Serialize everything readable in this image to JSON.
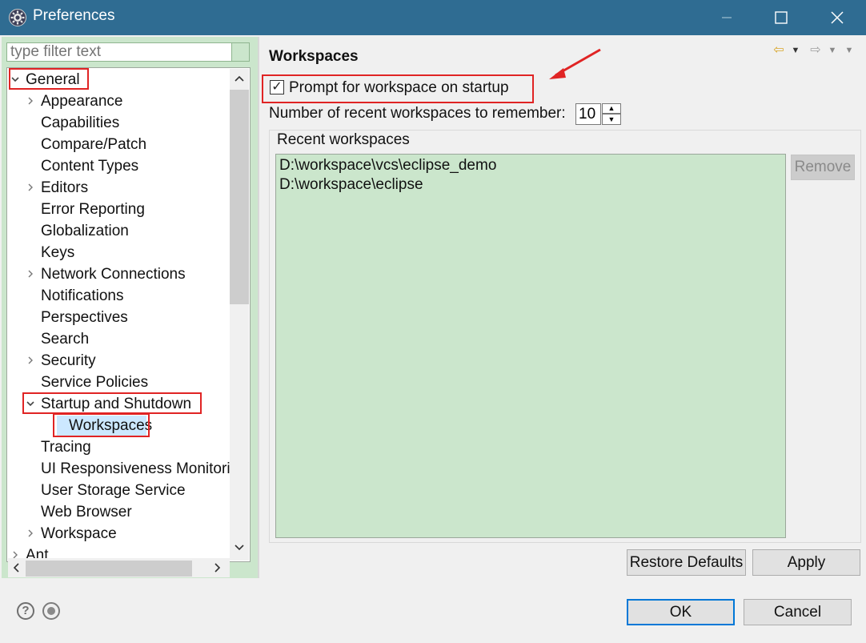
{
  "window": {
    "title": "Preferences",
    "icon": "eclipse-gear-icon",
    "buttons": [
      "minimize",
      "maximize",
      "close"
    ]
  },
  "filter": {
    "placeholder": "type filter text",
    "value": ""
  },
  "tree": {
    "items": [
      {
        "label": "General",
        "twisty": "expanded",
        "level": 0
      },
      {
        "label": "Appearance",
        "twisty": "collapsed",
        "level": 1
      },
      {
        "label": "Capabilities",
        "twisty": "none",
        "level": 1
      },
      {
        "label": "Compare/Patch",
        "twisty": "none",
        "level": 1
      },
      {
        "label": "Content Types",
        "twisty": "none",
        "level": 1
      },
      {
        "label": "Editors",
        "twisty": "collapsed",
        "level": 1
      },
      {
        "label": "Error Reporting",
        "twisty": "none",
        "level": 1
      },
      {
        "label": "Globalization",
        "twisty": "none",
        "level": 1
      },
      {
        "label": "Keys",
        "twisty": "none",
        "level": 1
      },
      {
        "label": "Network Connections",
        "twisty": "collapsed",
        "level": 1
      },
      {
        "label": "Notifications",
        "twisty": "none",
        "level": 1
      },
      {
        "label": "Perspectives",
        "twisty": "none",
        "level": 1
      },
      {
        "label": "Search",
        "twisty": "none",
        "level": 1
      },
      {
        "label": "Security",
        "twisty": "collapsed",
        "level": 1
      },
      {
        "label": "Service Policies",
        "twisty": "none",
        "level": 1
      },
      {
        "label": "Startup and Shutdown",
        "twisty": "expanded",
        "level": 1
      },
      {
        "label": "Workspaces",
        "twisty": "none",
        "level": 2,
        "selected": true
      },
      {
        "label": "Tracing",
        "twisty": "none",
        "level": 1
      },
      {
        "label": "UI Responsiveness Monitori",
        "twisty": "none",
        "level": 1
      },
      {
        "label": "User Storage Service",
        "twisty": "none",
        "level": 1
      },
      {
        "label": "Web Browser",
        "twisty": "none",
        "level": 1
      },
      {
        "label": "Workspace",
        "twisty": "collapsed",
        "level": 1
      },
      {
        "label": "Ant",
        "twisty": "collapsed",
        "level": 0
      }
    ]
  },
  "page": {
    "title": "Workspaces",
    "prompt_label": "Prompt for workspace on startup",
    "prompt_checked": true,
    "recent_count_label": "Number of recent workspaces to remember:",
    "recent_count_value": "10",
    "recent_group_label": "Recent workspaces",
    "recent_workspaces": [
      "D:\\workspace\\vcs\\eclipse_demo",
      "D:\\workspace\\eclipse"
    ],
    "remove_label": "Remove",
    "restore_defaults_label": "Restore Defaults",
    "apply_label": "Apply"
  },
  "footer": {
    "ok_label": "OK",
    "cancel_label": "Cancel"
  },
  "colors": {
    "titlebar": "#2f6c92",
    "list_bg": "#cbe6cc",
    "selection": "#cce8ff",
    "annotation_red": "#e02424"
  }
}
